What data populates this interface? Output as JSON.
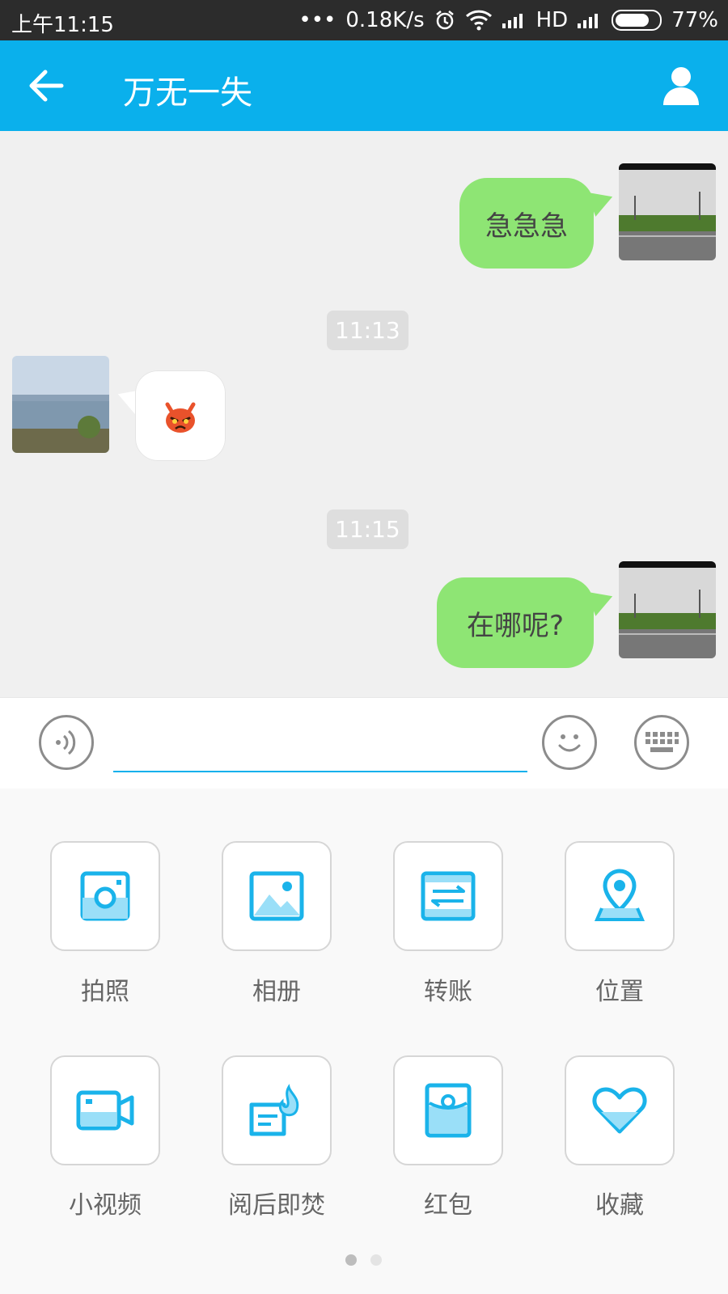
{
  "status_bar": {
    "time": "上午11:15",
    "dots": "•••",
    "net_speed": "0.18K/s",
    "hd": "HD",
    "battery": "77%"
  },
  "app_bar": {
    "title": "万无一失",
    "back_icon": "arrow-left-icon",
    "profile_icon": "person-icon"
  },
  "messages": [
    {
      "from": "me",
      "text": "急急急"
    },
    {
      "type": "time",
      "text": "11:13"
    },
    {
      "from": "other",
      "emoji": "😠"
    },
    {
      "type": "time",
      "text": "11:15"
    },
    {
      "from": "me",
      "text": "在哪呢?"
    }
  ],
  "input_bar": {
    "voice_icon": "voice-icon",
    "text_value": "",
    "emoji_icon": "smiley-icon",
    "keyboard_icon": "keyboard-icon"
  },
  "panel": {
    "items": [
      {
        "label": "拍照",
        "icon": "camera-icon"
      },
      {
        "label": "相册",
        "icon": "album-icon"
      },
      {
        "label": "转账",
        "icon": "transfer-icon"
      },
      {
        "label": "位置",
        "icon": "location-icon"
      },
      {
        "label": "小视频",
        "icon": "video-icon"
      },
      {
        "label": "阅后即焚",
        "icon": "burn-after-reading-icon"
      },
      {
        "label": "红包",
        "icon": "red-packet-icon"
      },
      {
        "label": "收藏",
        "icon": "favorite-icon"
      }
    ],
    "page_count": 2,
    "current_page": 1
  },
  "colors": {
    "accent": "#0ab0ec",
    "bubble_me": "#8ee574",
    "status_bar": "#2c2c2c"
  }
}
